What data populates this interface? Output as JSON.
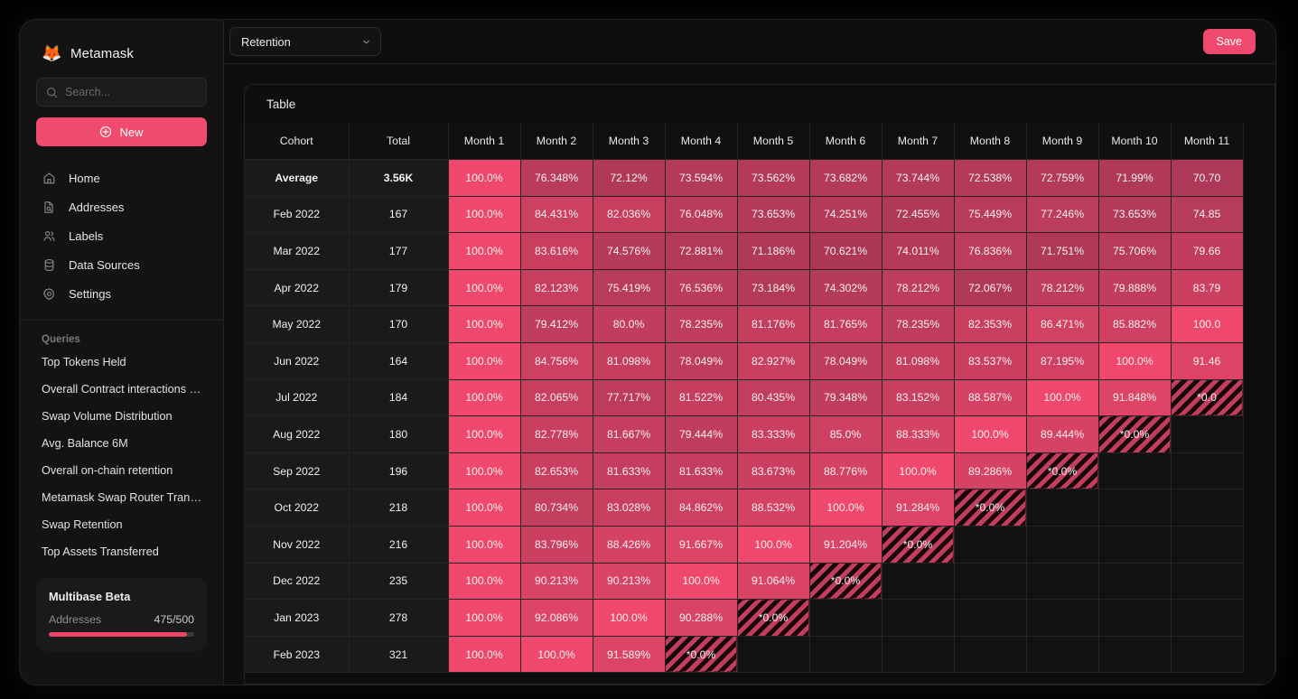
{
  "app": {
    "brand_name": "Metamask",
    "brand_icon": "fox-icon"
  },
  "sidebar": {
    "search": {
      "placeholder": "Search...",
      "value": ""
    },
    "new_button": "New",
    "nav_items": [
      {
        "label": "Home",
        "icon": "home-icon"
      },
      {
        "label": "Addresses",
        "icon": "document-search-icon"
      },
      {
        "label": "Labels",
        "icon": "people-icon"
      },
      {
        "label": "Data Sources",
        "icon": "database-icon"
      },
      {
        "label": "Settings",
        "icon": "gear-icon"
      }
    ],
    "queries_title": "Queries",
    "queries": [
      "Top Tokens Held",
      "Overall Contract interactions Le...",
      "Swap Volume Distribution",
      "Avg. Balance 6M",
      "Overall on-chain retention",
      "Metamask Swap Router Transa...",
      "Swap Retention",
      "Top Assets Transferred"
    ],
    "beta_card": {
      "title": "Multibase Beta",
      "metric_label": "Addresses",
      "metric_value": "475/500",
      "progress_pct": 95
    }
  },
  "toolbar": {
    "select_value": "Retention",
    "select_icon": "chevron-down-icon",
    "save_label": "Save"
  },
  "panel": {
    "title": "Table"
  },
  "chart_data": {
    "type": "heatmap",
    "title": "Table",
    "subtitle": "Retention",
    "xlabel": "",
    "ylabel": "Cohort",
    "legend": [],
    "grid": true,
    "colors": {
      "accent": "#ef4a6d",
      "cell_max": "#ef486c",
      "cell_min": "#b83a58",
      "hatched": "#c33e5c",
      "empty": "#111111",
      "panel_bg": "#0e0e0e",
      "sidebar_bg": "#131313"
    },
    "value_range": [
      70.0,
      100.0
    ],
    "null_marker": "*0.0%",
    "columns": [
      "Cohort",
      "Total",
      "Month 1",
      "Month 2",
      "Month 3",
      "Month 4",
      "Month 5",
      "Month 6",
      "Month 7",
      "Month 8",
      "Month 9",
      "Month 10",
      "Month 11"
    ],
    "categories": [
      "Average",
      "Feb 2022",
      "Mar 2022",
      "Apr 2022",
      "May 2022",
      "Jun 2022",
      "Jul 2022",
      "Aug 2022",
      "Sep 2022",
      "Oct 2022",
      "Nov 2022",
      "Dec 2022",
      "Jan 2023",
      "Feb 2023"
    ],
    "rows": [
      {
        "cohort": "Average",
        "total": "3.56K",
        "bold": true,
        "cells": [
          "100.0%",
          "76.348%",
          "72.12%",
          "73.594%",
          "73.562%",
          "73.682%",
          "73.744%",
          "72.538%",
          "72.759%",
          "71.99%",
          "70.70"
        ],
        "values": [
          100.0,
          76.348,
          72.12,
          73.594,
          73.562,
          73.682,
          73.744,
          72.538,
          72.759,
          71.99,
          70.707
        ]
      },
      {
        "cohort": "Feb 2022",
        "total": "167",
        "bold": false,
        "cells": [
          "100.0%",
          "84.431%",
          "82.036%",
          "76.048%",
          "73.653%",
          "74.251%",
          "72.455%",
          "75.449%",
          "77.246%",
          "73.653%",
          "74.85"
        ],
        "values": [
          100.0,
          84.431,
          82.036,
          76.048,
          73.653,
          74.251,
          72.455,
          75.449,
          77.246,
          73.653,
          74.85
        ]
      },
      {
        "cohort": "Mar 2022",
        "total": "177",
        "bold": false,
        "cells": [
          "100.0%",
          "83.616%",
          "74.576%",
          "72.881%",
          "71.186%",
          "70.621%",
          "74.011%",
          "76.836%",
          "71.751%",
          "75.706%",
          "79.66"
        ],
        "values": [
          100.0,
          83.616,
          74.576,
          72.881,
          71.186,
          70.621,
          74.011,
          76.836,
          71.751,
          75.706,
          79.66
        ]
      },
      {
        "cohort": "Apr 2022",
        "total": "179",
        "bold": false,
        "cells": [
          "100.0%",
          "82.123%",
          "75.419%",
          "76.536%",
          "73.184%",
          "74.302%",
          "78.212%",
          "72.067%",
          "78.212%",
          "79.888%",
          "83.79"
        ],
        "values": [
          100.0,
          82.123,
          75.419,
          76.536,
          73.184,
          74.302,
          78.212,
          72.067,
          78.212,
          79.888,
          83.79
        ]
      },
      {
        "cohort": "May 2022",
        "total": "170",
        "bold": false,
        "cells": [
          "100.0%",
          "79.412%",
          "80.0%",
          "78.235%",
          "81.176%",
          "81.765%",
          "78.235%",
          "82.353%",
          "86.471%",
          "85.882%",
          "100.0"
        ],
        "values": [
          100.0,
          79.412,
          80.0,
          78.235,
          81.176,
          81.765,
          78.235,
          82.353,
          86.471,
          85.882,
          100.0
        ]
      },
      {
        "cohort": "Jun 2022",
        "total": "164",
        "bold": false,
        "cells": [
          "100.0%",
          "84.756%",
          "81.098%",
          "78.049%",
          "82.927%",
          "78.049%",
          "81.098%",
          "83.537%",
          "87.195%",
          "100.0%",
          "91.46"
        ],
        "values": [
          100.0,
          84.756,
          81.098,
          78.049,
          82.927,
          78.049,
          81.098,
          83.537,
          87.195,
          100.0,
          91.46
        ]
      },
      {
        "cohort": "Jul 2022",
        "total": "184",
        "bold": false,
        "cells": [
          "100.0%",
          "82.065%",
          "77.717%",
          "81.522%",
          "80.435%",
          "79.348%",
          "83.152%",
          "88.587%",
          "100.0%",
          "91.848%",
          "*0.0"
        ],
        "values": [
          100.0,
          82.065,
          77.717,
          81.522,
          80.435,
          79.348,
          83.152,
          88.587,
          100.0,
          91.848,
          null
        ]
      },
      {
        "cohort": "Aug 2022",
        "total": "180",
        "bold": false,
        "cells": [
          "100.0%",
          "82.778%",
          "81.667%",
          "79.444%",
          "83.333%",
          "85.0%",
          "88.333%",
          "100.0%",
          "89.444%",
          "*0.0%",
          ""
        ],
        "values": [
          100.0,
          82.778,
          81.667,
          79.444,
          83.333,
          85.0,
          88.333,
          100.0,
          89.444,
          null,
          null
        ]
      },
      {
        "cohort": "Sep 2022",
        "total": "196",
        "bold": false,
        "cells": [
          "100.0%",
          "82.653%",
          "81.633%",
          "81.633%",
          "83.673%",
          "88.776%",
          "100.0%",
          "89.286%",
          "*0.0%",
          "",
          ""
        ],
        "values": [
          100.0,
          82.653,
          81.633,
          81.633,
          83.673,
          88.776,
          100.0,
          89.286,
          null,
          null,
          null
        ]
      },
      {
        "cohort": "Oct 2022",
        "total": "218",
        "bold": false,
        "cells": [
          "100.0%",
          "80.734%",
          "83.028%",
          "84.862%",
          "88.532%",
          "100.0%",
          "91.284%",
          "*0.0%",
          "",
          "",
          ""
        ],
        "values": [
          100.0,
          80.734,
          83.028,
          84.862,
          88.532,
          100.0,
          91.284,
          null,
          null,
          null,
          null
        ]
      },
      {
        "cohort": "Nov 2022",
        "total": "216",
        "bold": false,
        "cells": [
          "100.0%",
          "83.796%",
          "88.426%",
          "91.667%",
          "100.0%",
          "91.204%",
          "*0.0%",
          "",
          "",
          "",
          ""
        ],
        "values": [
          100.0,
          83.796,
          88.426,
          91.667,
          100.0,
          91.204,
          null,
          null,
          null,
          null,
          null
        ]
      },
      {
        "cohort": "Dec 2022",
        "total": "235",
        "bold": false,
        "cells": [
          "100.0%",
          "90.213%",
          "90.213%",
          "100.0%",
          "91.064%",
          "*0.0%",
          "",
          "",
          "",
          "",
          ""
        ],
        "values": [
          100.0,
          90.213,
          90.213,
          100.0,
          91.064,
          null,
          null,
          null,
          null,
          null,
          null
        ]
      },
      {
        "cohort": "Jan 2023",
        "total": "278",
        "bold": false,
        "cells": [
          "100.0%",
          "92.086%",
          "100.0%",
          "90.288%",
          "*0.0%",
          "",
          "",
          "",
          "",
          "",
          ""
        ],
        "values": [
          100.0,
          92.086,
          100.0,
          90.288,
          null,
          null,
          null,
          null,
          null,
          null,
          null
        ]
      },
      {
        "cohort": "Feb 2023",
        "total": "321",
        "bold": false,
        "cells": [
          "100.0%",
          "100.0%",
          "91.589%",
          "*0.0%",
          "",
          "",
          "",
          "",
          "",
          "",
          ""
        ],
        "values": [
          100.0,
          100.0,
          91.589,
          null,
          null,
          null,
          null,
          null,
          null,
          null,
          null
        ]
      }
    ]
  }
}
